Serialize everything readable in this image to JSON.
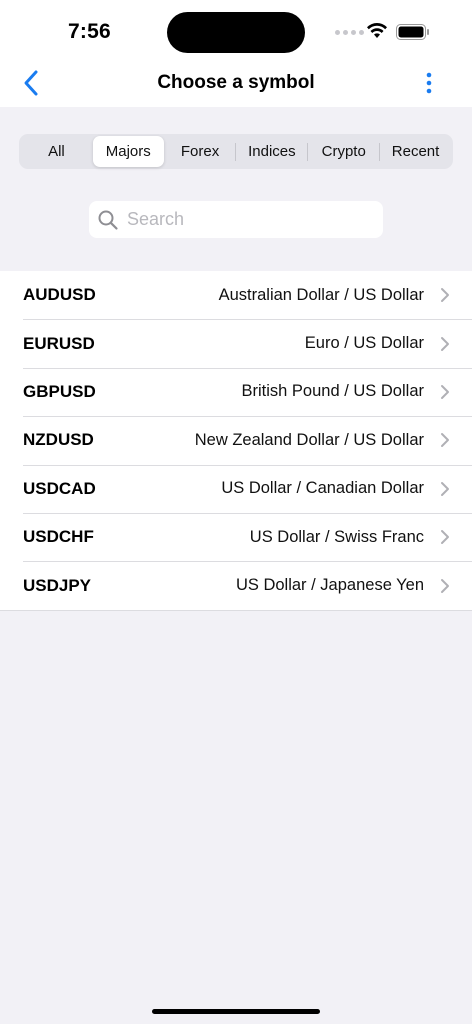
{
  "status": {
    "time": "7:56"
  },
  "nav": {
    "title": "Choose a symbol"
  },
  "tabs": [
    {
      "label": "All",
      "active": false
    },
    {
      "label": "Majors",
      "active": true
    },
    {
      "label": "Forex",
      "active": false
    },
    {
      "label": "Indices",
      "active": false
    },
    {
      "label": "Crypto",
      "active": false
    },
    {
      "label": "Recent",
      "active": false
    }
  ],
  "search": {
    "placeholder": "Search",
    "value": ""
  },
  "symbols": [
    {
      "code": "AUDUSD",
      "name": "Australian Dollar / US Dollar"
    },
    {
      "code": "EURUSD",
      "name": "Euro / US Dollar"
    },
    {
      "code": "GBPUSD",
      "name": "British Pound / US Dollar"
    },
    {
      "code": "NZDUSD",
      "name": "New Zealand Dollar / US Dollar"
    },
    {
      "code": "USDCAD",
      "name": "US Dollar / Canadian Dollar"
    },
    {
      "code": "USDCHF",
      "name": "US Dollar / Swiss Franc"
    },
    {
      "code": "USDJPY",
      "name": "US Dollar / Japanese Yen"
    }
  ],
  "colors": {
    "accent": "#1a7cf0",
    "background": "#f2f1f6",
    "separator": "#dcdce0"
  },
  "icons": {
    "back": "chevron-left-icon",
    "more": "more-vertical-icon",
    "search": "search-icon",
    "row": "chevron-right-icon"
  }
}
